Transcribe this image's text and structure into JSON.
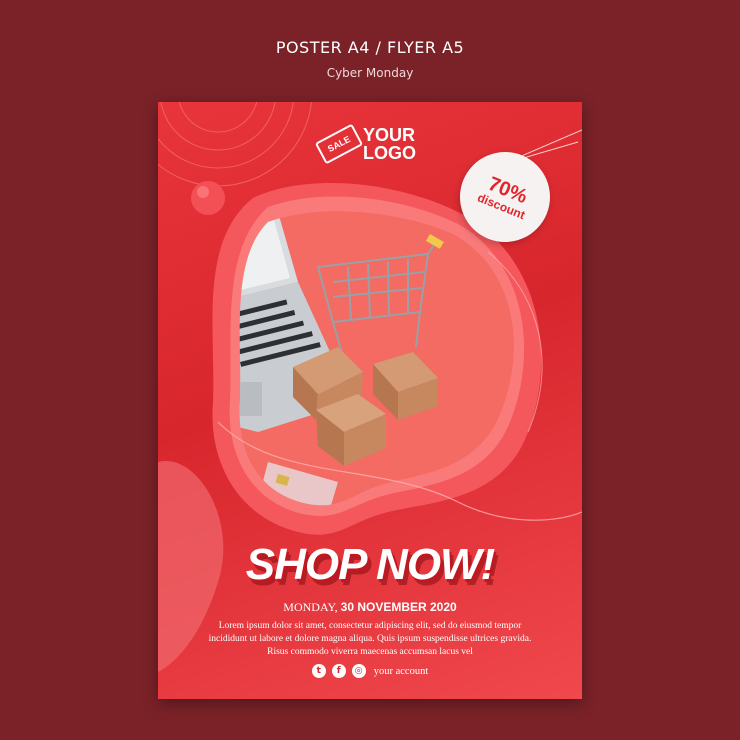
{
  "header": {
    "title": "POSTER A4 / FLYER A5",
    "subtitle": "Cyber Monday"
  },
  "poster": {
    "logo": {
      "tag_text": "SALE",
      "line1": "YOUR",
      "line2": "LOGO"
    },
    "discount": {
      "percent": "70%",
      "label": "discount"
    },
    "headline": "SHOP NOW!",
    "date_prefix": "MONDAY,",
    "date_bold": "30 NOVEMBER 2020",
    "body": "Lorem ipsum dolor sit amet, consectetur adipiscing elit, sed do eiusmod tempor incididunt ut labore et dolore magna aliqua. Quis ipsum suspendisse ultrices gravida. Risus commodo viverra maecenas accumsan lacus vel",
    "social": {
      "icons": [
        "twitter-icon",
        "facebook-icon",
        "instagram-icon"
      ],
      "account": "your account"
    }
  },
  "colors": {
    "page_bg": "#7a2228",
    "poster_red": "#e0262d",
    "text": "#ffffff"
  }
}
